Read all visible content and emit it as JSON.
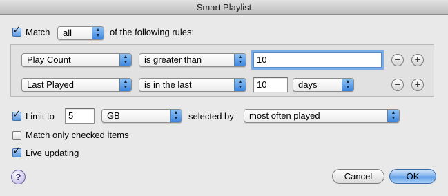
{
  "window": {
    "title": "Smart Playlist"
  },
  "match": {
    "checked": true,
    "label": "Match",
    "mode": "all",
    "suffix": "of the following rules:"
  },
  "rules": [
    {
      "field": "Play Count",
      "condition": "is greater than",
      "value": "10",
      "remove": "−",
      "add": "+"
    },
    {
      "field": "Last Played",
      "condition": "is in the last",
      "value": "10",
      "unit": "days",
      "remove": "−",
      "add": "+"
    }
  ],
  "limit": {
    "checked": true,
    "label": "Limit to",
    "value": "5",
    "unit": "GB",
    "selected_by_label": "selected by",
    "selected_by": "most often played"
  },
  "match_checked_only": {
    "checked": false,
    "label": "Match only checked items"
  },
  "live_updating": {
    "checked": true,
    "label": "Live updating"
  },
  "buttons": {
    "help": "?",
    "cancel": "Cancel",
    "ok": "OK"
  },
  "icons": {
    "checkmark": "checkmark-icon",
    "popup_arrows": "popup-arrows-icon"
  },
  "colors": {
    "accent": "#5b9be6",
    "window_bg": "#e9e9e9"
  }
}
